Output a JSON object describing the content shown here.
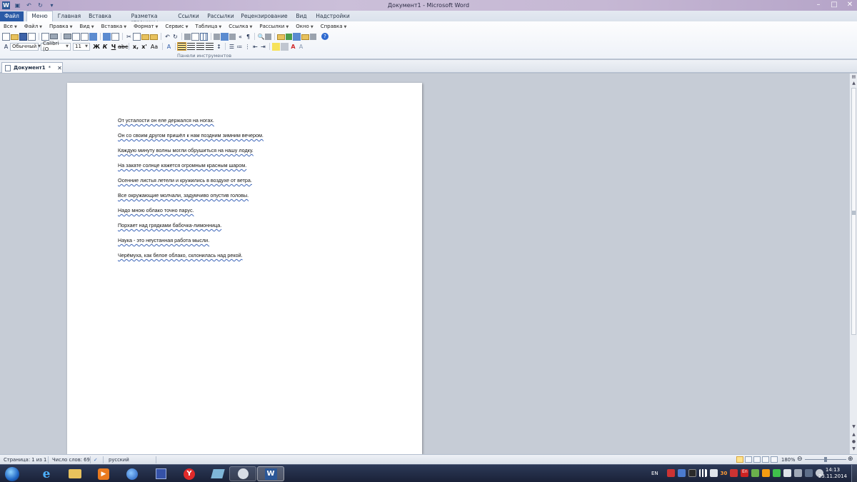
{
  "window": {
    "title": "Документ1 - Microsoft Word",
    "app_icon_letter": "W",
    "controls": [
      "–",
      "□",
      "✕"
    ]
  },
  "ribbon_tabs": [
    "Файл",
    "Меню",
    "Главная",
    "Вставка",
    "Разметка страницы",
    "Ссылки",
    "Рассылки",
    "Рецензирование",
    "Вид",
    "Надстройки"
  ],
  "active_tab": "Меню",
  "classic_menu": [
    "Все",
    "Файл",
    "Правка",
    "Вид",
    "Вставка",
    "Формат",
    "Сервис",
    "Таблица",
    "Ссылка",
    "Рассылки",
    "Окно",
    "Справка"
  ],
  "toolbar_format": {
    "style": "Обычный",
    "font": "Calibri (О",
    "size": "11",
    "bold": "Ж",
    "italic": "К",
    "underline": "Ч",
    "subscript": "x,",
    "superscript": "x'",
    "case": "Aa"
  },
  "group_label": "Панели инструментов",
  "document_tab": {
    "name": "Документ1",
    "modified": "*",
    "close": "✕"
  },
  "document_lines": [
    "От усталости он еле держался на ногах.",
    "Он со своим другом пришёл к нам поздним зимним вечером.",
    "Каждую минуту волны могли обрушиться на нашу лодку.",
    "На закате солнце кажется огромным красным шаром.",
    "Осенние листья летели и кружились в воздухе от ветра.",
    "Все окружающие молчали, задумчиво опустив головы.",
    "Надо мною облако точно парус.",
    "Порхает над грядками бабочка-лимонница.",
    "Наука - это неустанная работа мысли.",
    "Черёмуха, как белое облако, склонилась над рекой."
  ],
  "status_bar": {
    "page": "Страница: 1 из 1",
    "words": "Число слов: 69",
    "language": "русский",
    "zoom": "180%",
    "zoom_out": "⊖",
    "zoom_in": "⊕"
  },
  "taskbar": {
    "lang": "EN",
    "tray_number": "30",
    "time": "14:13",
    "date": "23.11.2014",
    "pinned": [
      "ie-icon",
      "explorer-icon",
      "media-player-icon",
      "browser-icon",
      "save-icon",
      "yandex-icon",
      "tablet-icon",
      "media-icon",
      "word-icon"
    ]
  },
  "colors": {
    "file_tab": "#2a5aa6",
    "spellcheck_underline": "#3a63b8",
    "selected_button": "#ffe38b",
    "taskbar": "#1a2238"
  }
}
